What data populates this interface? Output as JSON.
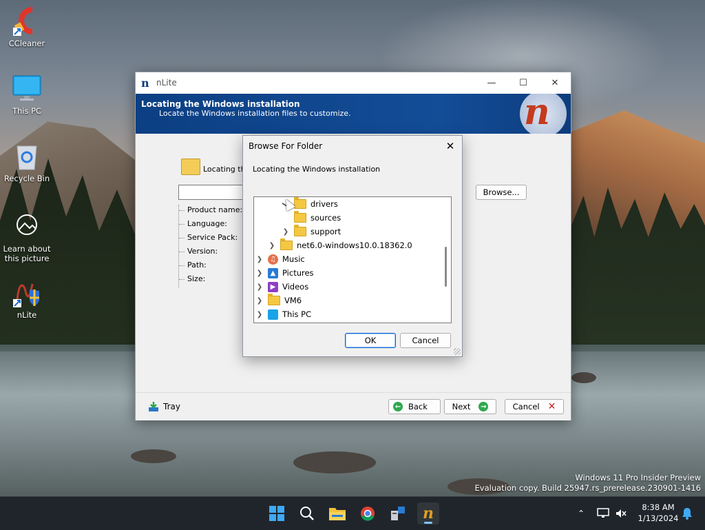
{
  "desktop": {
    "icons": [
      {
        "label": "CCleaner"
      },
      {
        "label": "This PC"
      },
      {
        "label": "Recycle Bin"
      },
      {
        "label": "Learn about this picture"
      },
      {
        "label": "nLite"
      }
    ],
    "watermark": {
      "line1": "Windows 11 Pro Insider Preview",
      "line2": "Evaluation copy. Build 25947.rs_prerelease.230901-1416"
    }
  },
  "nlite": {
    "title": "nLite",
    "logo_char": "n",
    "banner_heading": "Locating the Windows installation",
    "banner_subheading": "Locate the Windows installation files to customize.",
    "locate_label": "Locating the",
    "browse_label": "Browse...",
    "info_items": [
      "Product name:",
      "Language:",
      "Service Pack:",
      "Version:",
      "Path:",
      "Size:"
    ],
    "tray_label": "Tray",
    "back_label": "Back",
    "next_label": "Next",
    "cancel_label": "Cancel"
  },
  "browse_dialog": {
    "title": "Browse For Folder",
    "description": "Locating the Windows installation",
    "tree": [
      {
        "label": "drivers",
        "icon": "folder",
        "expander": "expanded"
      },
      {
        "label": "sources",
        "icon": "folder",
        "expander": "none"
      },
      {
        "label": "support",
        "icon": "folder",
        "expander": "collapsed"
      },
      {
        "label": "net6.0-windows10.0.18362.0",
        "icon": "folder",
        "expander": "collapsed"
      },
      {
        "label": "Music",
        "icon": "music-icon",
        "expander": "collapsed"
      },
      {
        "label": "Pictures",
        "icon": "pictures-icon",
        "expander": "collapsed"
      },
      {
        "label": "Videos",
        "icon": "videos-icon",
        "expander": "collapsed"
      },
      {
        "label": "VM6",
        "icon": "folder",
        "expander": "collapsed"
      },
      {
        "label": "This PC",
        "icon": "pc-icon",
        "expander": "collapsed"
      }
    ],
    "ok_label": "OK",
    "cancel_label": "Cancel"
  },
  "taskbar": {
    "time": "8:38 AM",
    "date": "1/13/2024"
  },
  "colors": {
    "banner": "#134d97",
    "taskbar": "#20252b",
    "accent": "#0a64d2"
  }
}
